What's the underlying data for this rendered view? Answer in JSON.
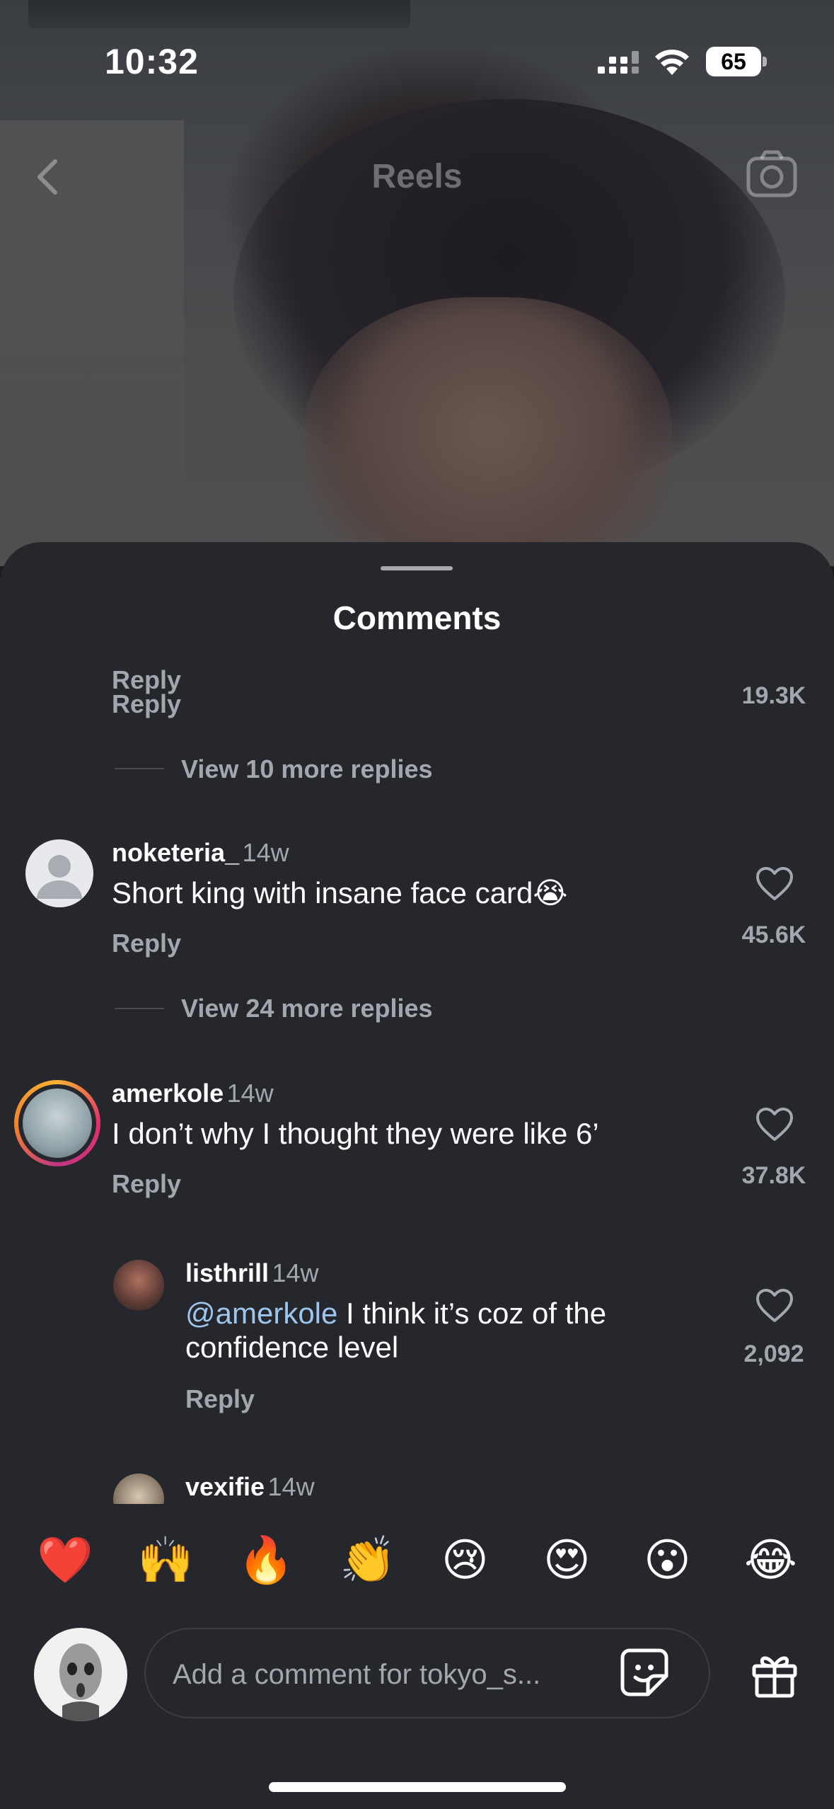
{
  "status_bar": {
    "time": "10:32",
    "battery": "65"
  },
  "header": {
    "title": "Reels"
  },
  "sheet": {
    "title": "Comments"
  },
  "comments": {
    "top_partial": {
      "reply_label": "Reply",
      "likes": "19.3K",
      "view_more": "View 10 more replies"
    },
    "c1": {
      "username": "noketeria_",
      "time": "14w",
      "text": "Short king with insane face card😭",
      "reply_label": "Reply",
      "likes": "45.6K",
      "view_more": "View 24 more replies"
    },
    "c2": {
      "username": "amerkole",
      "time": "14w",
      "text": "I don’t why I thought they were like 6’",
      "reply_label": "Reply",
      "likes": "37.8K"
    },
    "c2_reply": {
      "username": "listhrill",
      "time": "14w",
      "mention": "@amerkole",
      "text_line1": " I think it’s coz of the",
      "text_line2": "confidence level",
      "reply_label": "Reply",
      "likes": "2,092"
    },
    "c3_partial": {
      "username": "vexifie",
      "time": "14w"
    }
  },
  "emojis": [
    "❤️",
    "🙌",
    "🔥",
    "👏",
    "😢",
    "😍",
    "😮",
    "😂"
  ],
  "input": {
    "placeholder": "Add a comment for tokyo_s..."
  },
  "icons": {
    "back": "chevron-left-icon",
    "camera": "camera-icon",
    "heart": "heart-outline-icon",
    "sticker": "sticker-icon",
    "gift": "gift-icon"
  }
}
